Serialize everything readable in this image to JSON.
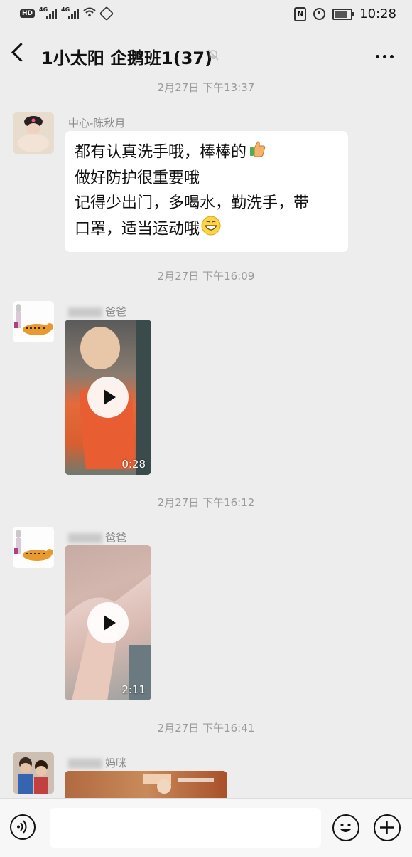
{
  "status_bar": {
    "hd_label": "HD",
    "sim1_label": "4G",
    "sim2_label": "4G",
    "wifi_icon": "wifi-icon",
    "nfc_label": "N",
    "time": "10:28"
  },
  "header": {
    "title": "1小太阳 企鹅班1(37)",
    "back_icon": "chevron-left-icon",
    "mute_icon": "bell-muted-icon",
    "more_icon": "more-dots-icon"
  },
  "messages": [
    {
      "timestamp": "2月27日 下午13:37",
      "sender": "中心-陈秋月",
      "type": "text",
      "lines": [
        "都有认真洗手哦，棒棒的",
        "做好防护很重要哦",
        "记得少出门，多喝水，勤洗手，带",
        "口罩，适当运动哦"
      ]
    },
    {
      "timestamp": "2月27日 下午16:09",
      "sender": "爸爸",
      "type": "video",
      "duration": "0:28"
    },
    {
      "timestamp": "2月27日 下午16:12",
      "sender": "爸爸",
      "type": "video",
      "duration": "2:11"
    },
    {
      "timestamp": "2月27日 下午16:41",
      "sender": "妈咪",
      "type": "image"
    }
  ],
  "input_bar": {
    "voice_icon": "voice-icon",
    "message_placeholder": "",
    "emoji_icon": "emoji-icon",
    "plus_icon": "plus-icon"
  },
  "colors": {
    "background": "#ededed",
    "bubble": "#ffffff",
    "timestamp_text": "#9a9a9a"
  }
}
